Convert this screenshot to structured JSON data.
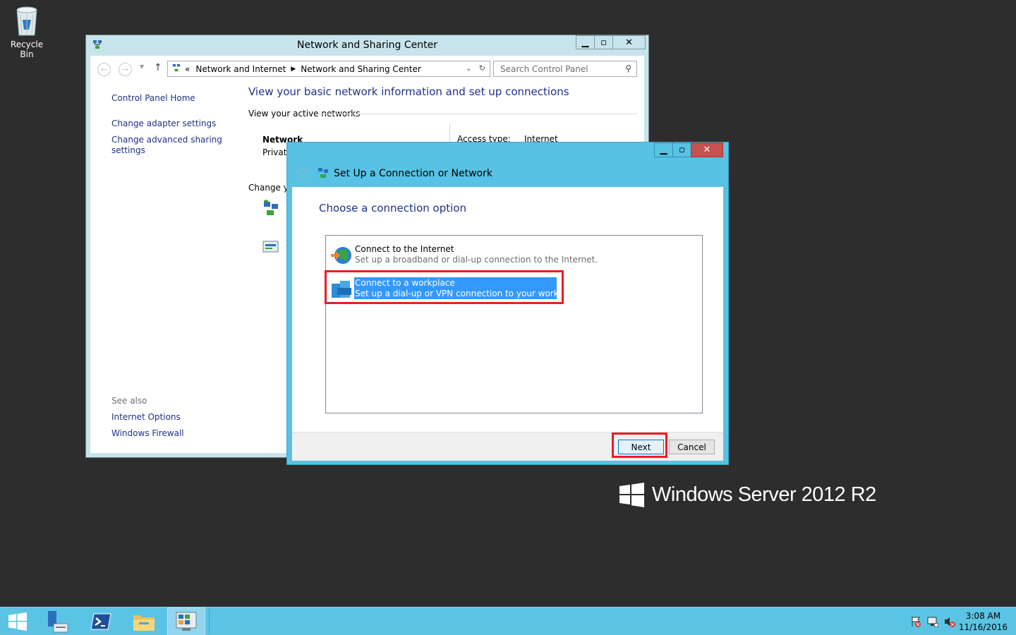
{
  "desktop": {
    "recycle_bin_label": "Recycle Bin",
    "brand": "Windows Server 2012 R2"
  },
  "main_window": {
    "title": "Network and Sharing Center",
    "address": {
      "prefix": "«",
      "crumb1": "Network and Internet",
      "crumb2": "Network and Sharing Center"
    },
    "search_placeholder": "Search Control Panel",
    "left_links": [
      "Control Panel Home",
      "Change adapter settings",
      "Change advanced sharing",
      "settings"
    ],
    "see_also_label": "See also",
    "see_also_links": [
      "Internet Options",
      "Windows Firewall"
    ],
    "heading": "View your basic network information and set up connections",
    "active_networks_label": "View your active networks",
    "network_name": "Network",
    "network_type": "Private",
    "access_type_label": "Access type:",
    "access_type_value": "Internet",
    "change_label": "Change yo"
  },
  "dialog": {
    "title": "Set Up a Connection or Network",
    "heading": "Choose a connection option",
    "options": [
      {
        "title": "Connect to the Internet",
        "desc": "Set up a broadband or dial-up connection to the Internet.",
        "icon": "globe-icon",
        "selected": false
      },
      {
        "title": "Connect to a workplace",
        "desc": "Set up a dial-up or VPN connection to your workplace.",
        "icon": "workplace-icon",
        "selected": true
      }
    ],
    "next_label": "Next",
    "cancel_label": "Cancel"
  },
  "taskbar": {
    "time": "3:08 AM",
    "date": "11/16/2016",
    "items": [
      "start-icon",
      "server-manager-icon",
      "powershell-icon",
      "file-explorer-icon",
      "control-panel-icon"
    ]
  },
  "colors": {
    "accent": "#57c2e4",
    "link": "#1e3287",
    "selection": "#3399ff",
    "highlight_box": "#ec1c24"
  }
}
